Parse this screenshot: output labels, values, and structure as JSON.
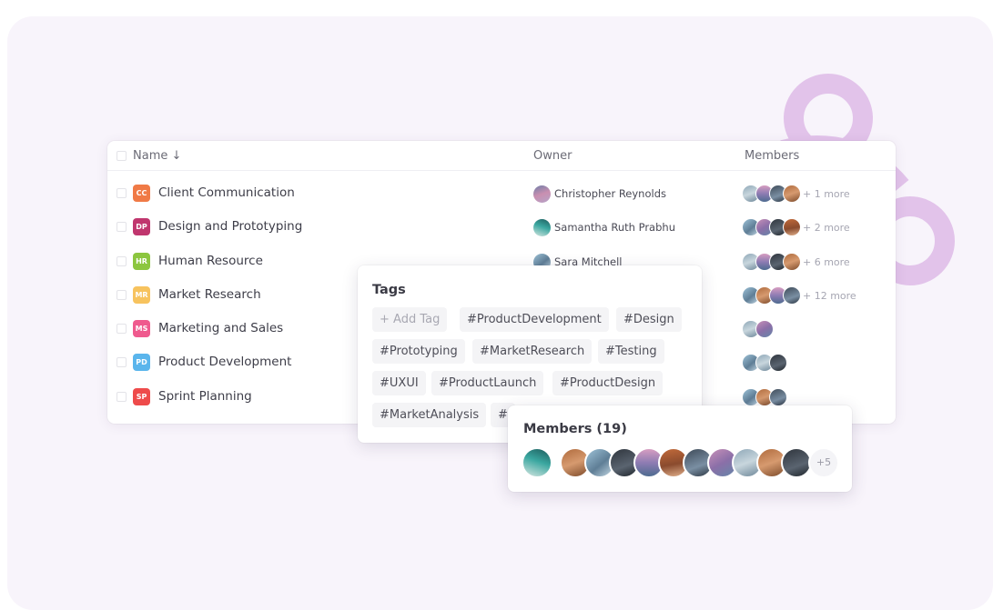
{
  "colors": {
    "page_bg": "#f8f4fb",
    "accent_deco": "#e2c3ea",
    "badge_cc": "#f07a46",
    "badge_dp": "#c0366e",
    "badge_hr": "#8cc63f",
    "badge_mr": "#f7c35e",
    "badge_ms": "#ef5a8e",
    "badge_pd": "#5ab5ec",
    "badge_sp": "#ee4b4b"
  },
  "table": {
    "headers": {
      "name": "Name ↓",
      "owner": "Owner",
      "members": "Members"
    },
    "rows": [
      {
        "badge": "CC",
        "badge_color": "#f07a46",
        "name": "Client Communication",
        "owner": "Christopher Reynolds",
        "more": "+ 1 more"
      },
      {
        "badge": "DP",
        "badge_color": "#c0366e",
        "name": "Design and Prototyping",
        "owner": "Samantha Ruth Prabhu",
        "more": "+ 2 more"
      },
      {
        "badge": "HR",
        "badge_color": "#8cc63f",
        "name": "Human Resource",
        "owner": "Sara Mitchell",
        "more": "+ 6 more"
      },
      {
        "badge": "MR",
        "badge_color": "#f7c35e",
        "name": "Market Research",
        "owner": "",
        "more": "+ 12 more"
      },
      {
        "badge": "MS",
        "badge_color": "#ef5a8e",
        "name": "Marketing and Sales",
        "owner": "",
        "more": ""
      },
      {
        "badge": "PD",
        "badge_color": "#5ab5ec",
        "name": "Product Development",
        "owner": "",
        "more": ""
      },
      {
        "badge": "SP",
        "badge_color": "#ee4b4b",
        "name": "Sprint Planning",
        "owner": "",
        "more": ""
      }
    ]
  },
  "tags_popover": {
    "title": "Tags",
    "add_tag": "+ Add Tag",
    "tags": [
      "#ProductDevelopment",
      "#Design",
      "#Prototyping",
      "#MarketResearch",
      "#Testing",
      "#UXUI",
      "#ProductLaunch",
      "#ProductDesign",
      "#MarketAnalysis",
      "#"
    ]
  },
  "members_popover": {
    "title": "Members (19)",
    "overflow": "+5"
  }
}
